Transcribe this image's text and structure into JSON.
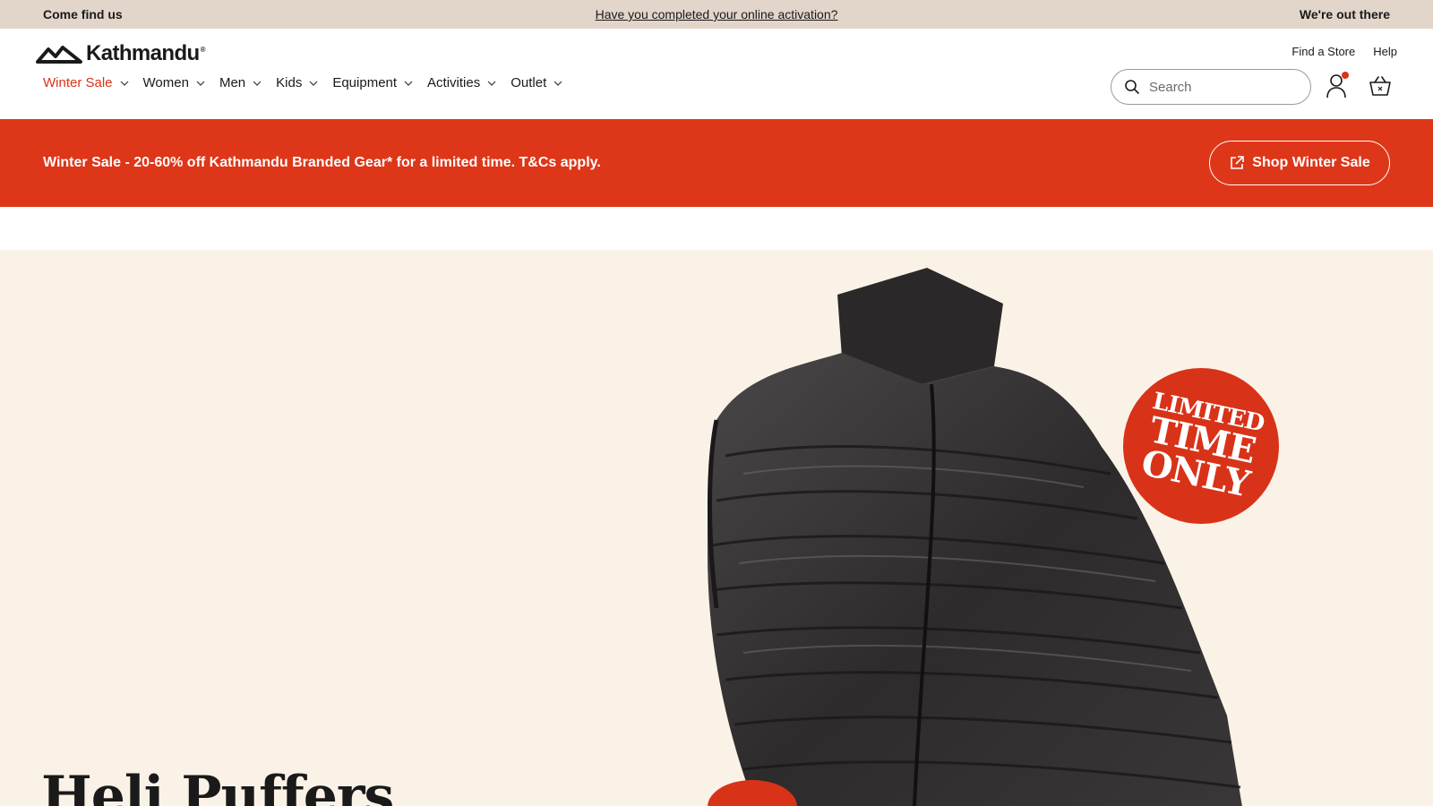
{
  "announcement": {
    "left": "Come find us",
    "center": "Have you completed your online activation?",
    "right": "We're out there"
  },
  "brand": {
    "name": "Kathmandu",
    "reg_mark": "®"
  },
  "utility": {
    "find_store": "Find a Store",
    "help": "Help"
  },
  "nav": [
    {
      "label": "Winter Sale",
      "highlight": true
    },
    {
      "label": "Women"
    },
    {
      "label": "Men"
    },
    {
      "label": "Kids"
    },
    {
      "label": "Equipment"
    },
    {
      "label": "Activities"
    },
    {
      "label": "Outlet"
    }
  ],
  "search": {
    "placeholder": "Search",
    "value": ""
  },
  "icons": {
    "search": "search-icon",
    "account": "user-icon",
    "cart": "basket-icon",
    "external": "external-link-icon",
    "chevron": "chevron-down-icon"
  },
  "promo": {
    "text": "Winter Sale - 20-60% off Kathmandu Branded Gear* for a limited time. T&Cs apply.",
    "button_label": "Shop Winter Sale"
  },
  "hero": {
    "title": "Heli Puffers",
    "badge": {
      "line1": "LIMITED",
      "line2": "TIME",
      "line3": "ONLY"
    }
  },
  "colors": {
    "accent": "#de3618",
    "sale_text": "#d8341a",
    "announcement_bg": "#e2d5c9",
    "hero_bg": "#fbf2e7"
  }
}
